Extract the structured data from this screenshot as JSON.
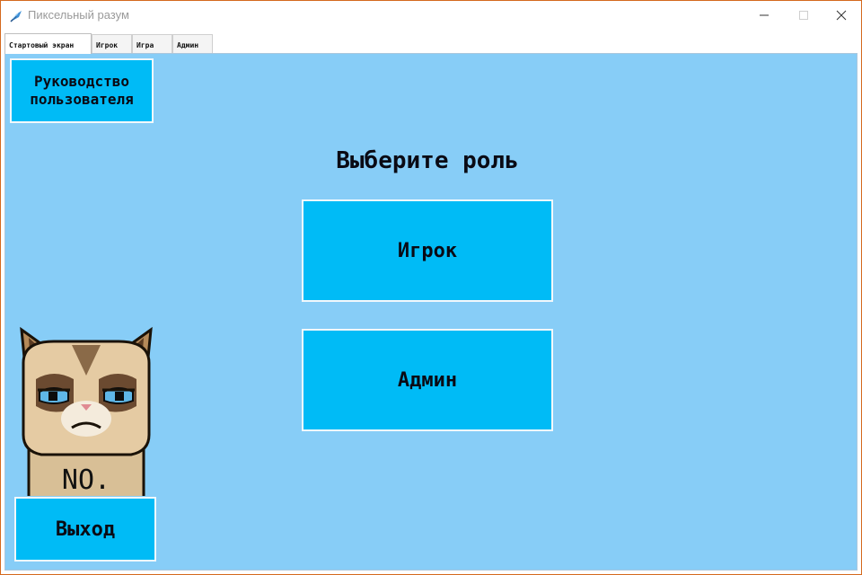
{
  "window": {
    "title": "Пиксельный разум"
  },
  "tabs": [
    {
      "label": "Стартовый экран"
    },
    {
      "label": "Игрок"
    },
    {
      "label": "Игра"
    },
    {
      "label": "Админ"
    }
  ],
  "main": {
    "guide_button": "Руководство пользователя",
    "heading": "Выберите роль",
    "player_button": "Игрок",
    "admin_button": "Админ",
    "exit_button": "Выход"
  },
  "cat_image": {
    "sign_text": "NO."
  },
  "colors": {
    "background": "#87cdf7",
    "button": "#00bbf6",
    "button_border": "#f2f8fc",
    "text": "#0a0a14"
  },
  "icons": {
    "app": "feather-icon",
    "minimize": "minimize-icon",
    "maximize": "maximize-icon",
    "close": "close-icon"
  }
}
